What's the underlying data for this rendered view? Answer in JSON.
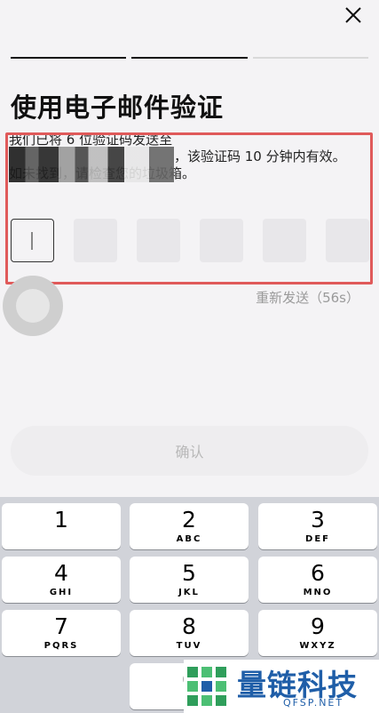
{
  "progress": {
    "total_steps": 3,
    "current_step": 2
  },
  "title": "使用电子邮件验证",
  "description": {
    "line1": "我们已将 6 位验证码发送至",
    "line2_suffix": "，该验证码 10 分钟内有效。",
    "line3": "如未找到，请检查您的垃圾箱。"
  },
  "code_length": 6,
  "resend_label": "重新发送（56s）",
  "confirm_label": "确认",
  "keyboard": {
    "keys": [
      {
        "num": "1",
        "letters": ""
      },
      {
        "num": "2",
        "letters": "ABC"
      },
      {
        "num": "3",
        "letters": "DEF"
      },
      {
        "num": "4",
        "letters": "GHI"
      },
      {
        "num": "5",
        "letters": "JKL"
      },
      {
        "num": "6",
        "letters": "MNO"
      },
      {
        "num": "7",
        "letters": "PQRS"
      },
      {
        "num": "8",
        "letters": "TUV"
      },
      {
        "num": "9",
        "letters": "WXYZ"
      },
      {
        "num": "",
        "letters": ""
      },
      {
        "num": "0",
        "letters": ""
      }
    ]
  },
  "watermark": {
    "name": "量链科技",
    "site": "QFSP.NET"
  },
  "colors": {
    "highlight": "#e05a5a",
    "brand": "#1f5ea8"
  }
}
